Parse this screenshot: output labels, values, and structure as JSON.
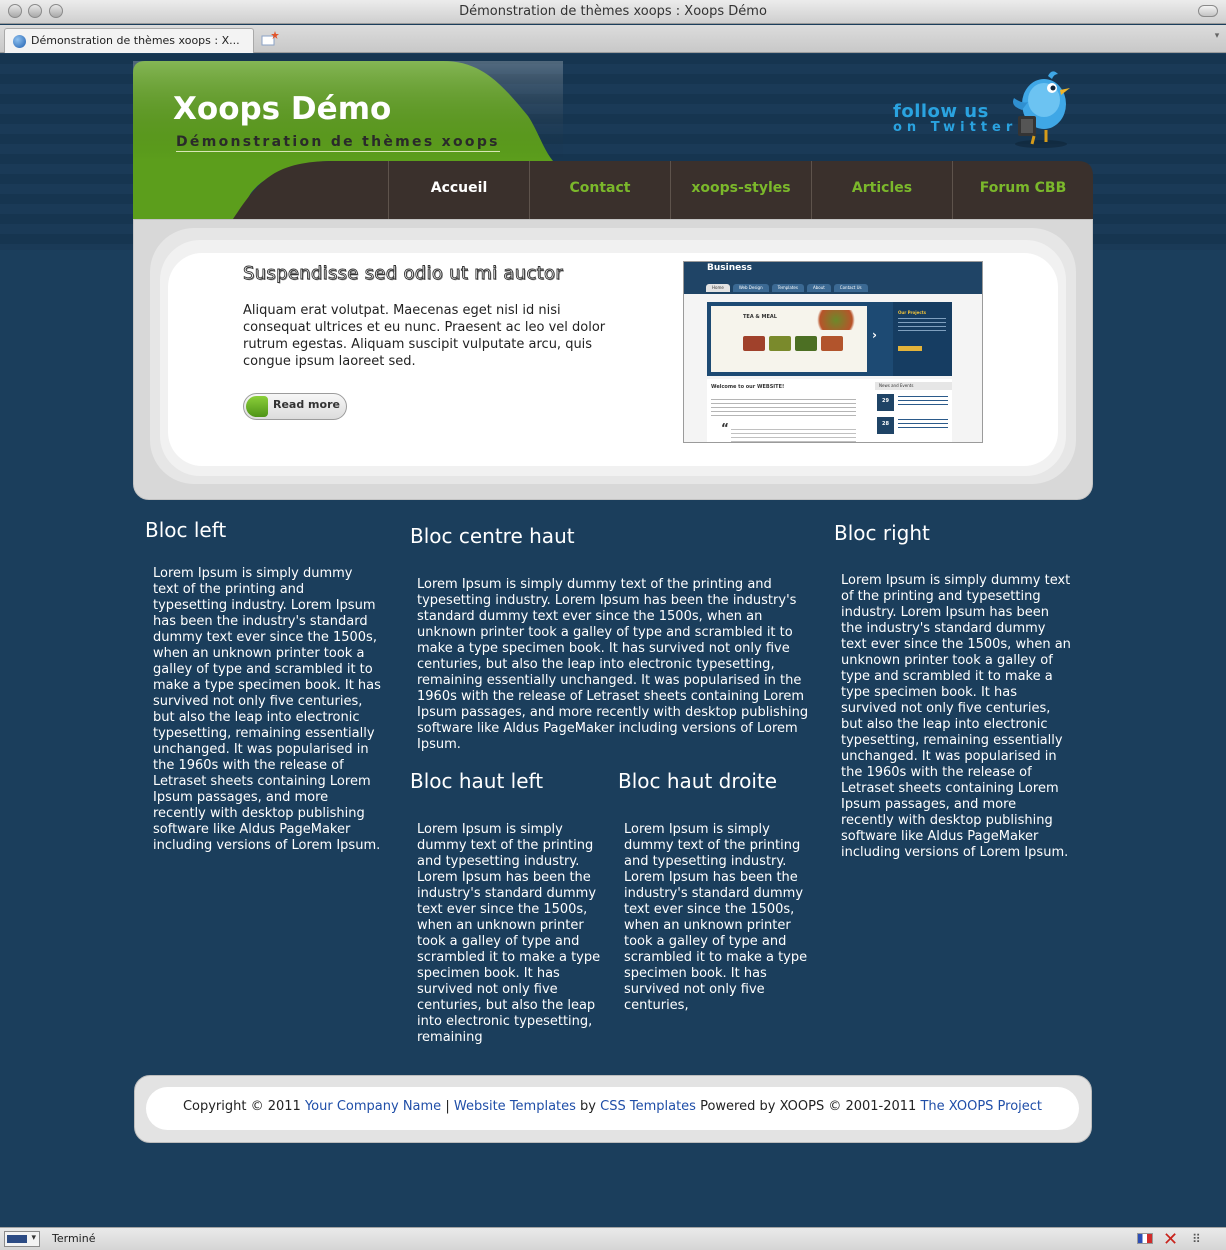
{
  "browser": {
    "window_title": "Démonstration de thèmes xoops : Xoops Démo",
    "tab_title": "Démonstration de thèmes xoops : X...",
    "status_text": "Terminé"
  },
  "header": {
    "site_title": "Xoops Démo",
    "slogan": "Démonstration de thèmes xoops",
    "follow_line1": "follow us",
    "follow_line2": "on Twitter"
  },
  "nav": {
    "items": [
      {
        "label": "Accueil"
      },
      {
        "label": "Contact"
      },
      {
        "label": "xoops-styles"
      },
      {
        "label": "Articles"
      },
      {
        "label": "Forum CBB"
      }
    ]
  },
  "slider": {
    "title": "Suspendisse sed odio ut mi auctor",
    "text": "Aliquam erat volutpat. Maecenas eget nisl id nisi consequat ultrices et eu nunc. Praesent ac leo vel dolor rutrum egestas. Aliquam suscipit vulputate arcu, quis congue ipsum laoreet sed.",
    "read_more": "Read more",
    "shot": {
      "brand": "Business",
      "tabs": [
        "Home",
        "Web Design",
        "Templates",
        "About",
        "Contact Us"
      ],
      "banner_title": "TEA & MEAL",
      "side_title": "Our Projects",
      "welcome": "Welcome to our WEBSITE!",
      "news": "News and Events",
      "date1": "29",
      "date2": "28"
    }
  },
  "blocks": {
    "left": {
      "title": "Bloc left",
      "text": "Lorem Ipsum is simply dummy text of the printing and typesetting industry. Lorem Ipsum has been the industry's standard dummy text ever since the 1500s, when an unknown printer took a galley of type and scrambled it to make a type specimen book. It has survived not only five centuries, but also the leap into electronic typesetting, remaining essentially unchanged. It was popularised in the 1960s with the release of Letraset sheets containing Lorem Ipsum passages, and more recently with desktop publishing software like Aldus PageMaker including versions of Lorem Ipsum."
    },
    "center_top": {
      "title": "Bloc centre haut",
      "text": "Lorem Ipsum is simply dummy text of the printing and typesetting industry. Lorem Ipsum has been the industry's standard dummy text ever since the 1500s, when an unknown printer took a galley of type and scrambled it to make a type specimen book. It has survived not only five centuries, but also the leap into electronic typesetting, remaining essentially unchanged. It was popularised in the 1960s with the release of Letraset sheets containing Lorem Ipsum passages, and more recently with desktop publishing software like Aldus PageMaker including versions of Lorem Ipsum."
    },
    "top_left": {
      "title": "Bloc haut left",
      "text": "Lorem Ipsum is simply dummy text of the printing and typesetting industry. Lorem Ipsum has been the industry's standard dummy text ever since the 1500s, when an unknown printer took a galley of type and scrambled it to make a type specimen book. It has survived not only five centuries, but also the leap into electronic typesetting, remaining"
    },
    "top_right": {
      "title": "Bloc haut droite",
      "text": "Lorem Ipsum is simply dummy text of the printing and typesetting industry. Lorem Ipsum has been the industry's standard dummy text ever since the 1500s, when an unknown printer took a galley of type and scrambled it to make a type specimen book. It has survived not only five centuries,"
    },
    "right": {
      "title": "Bloc right",
      "text": "Lorem Ipsum is simply dummy text of the printing and typesetting industry. Lorem Ipsum has been the industry's standard dummy text ever since the 1500s, when an unknown printer took a galley of type and scrambled it to make a type specimen book. It has survived not only five centuries, but also the leap into electronic typesetting, remaining essentially unchanged. It was popularised in the 1960s with the release of Letraset sheets containing Lorem Ipsum passages, and more recently with desktop publishing software like Aldus PageMaker including versions of Lorem Ipsum."
    }
  },
  "footer": {
    "copyright": "Copyright © 2011",
    "company_link": "Your Company Name",
    "separator": "|",
    "templates_link": "Website Templates",
    "by": "by",
    "css_link": "CSS Templates",
    "powered": "Powered by XOOPS © 2001-2011",
    "xoops_link": "The XOOPS Project"
  },
  "colors": {
    "page_bg": "#1b3e5c",
    "header_green": "#5c9e1c",
    "nav_dark": "#3a302c",
    "nav_link": "#7bb82b",
    "footer_link": "#1f4ea8",
    "twitter_blue": "#2aa3e0"
  }
}
